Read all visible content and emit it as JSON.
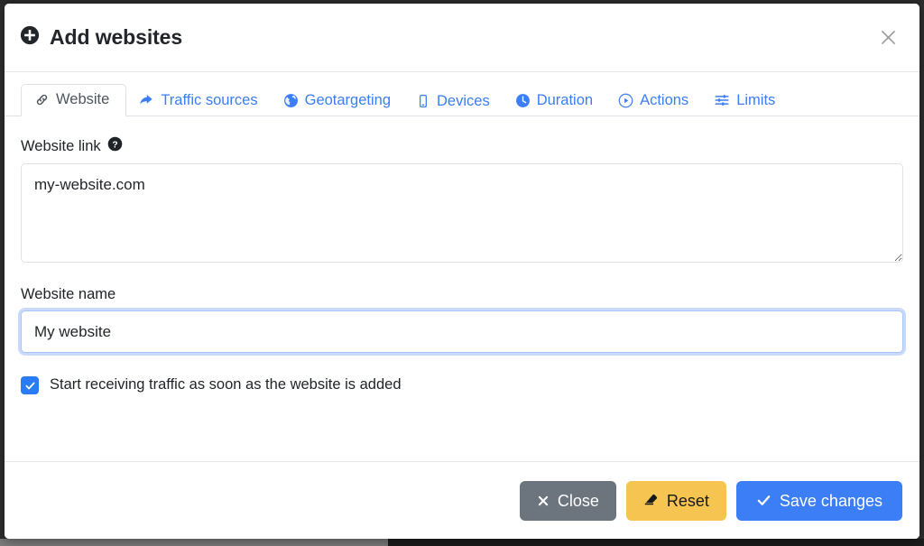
{
  "modal": {
    "title": "Add websites",
    "title_icon": "plus-circle-icon",
    "close_icon": "close-icon"
  },
  "tabs": [
    {
      "label": "Website",
      "icon": "link-icon",
      "active": true
    },
    {
      "label": "Traffic sources",
      "icon": "share-icon",
      "active": false
    },
    {
      "label": "Geotargeting",
      "icon": "globe-icon",
      "active": false
    },
    {
      "label": "Devices",
      "icon": "mobile-icon",
      "active": false
    },
    {
      "label": "Duration",
      "icon": "clock-icon",
      "active": false
    },
    {
      "label": "Actions",
      "icon": "play-icon",
      "active": false
    },
    {
      "label": "Limits",
      "icon": "sliders-icon",
      "active": false
    }
  ],
  "form": {
    "website_link": {
      "label": "Website link",
      "help_icon": "help-circle-icon",
      "value": "my-website.com",
      "placeholder": ""
    },
    "website_name": {
      "label": "Website name",
      "value": "My website",
      "placeholder": ""
    },
    "start_traffic": {
      "label": "Start receiving traffic as soon as the website is added",
      "checked": true
    }
  },
  "footer": {
    "close_label": "Close",
    "close_icon": "x-icon",
    "reset_label": "Reset",
    "reset_icon": "eraser-icon",
    "save_label": "Save changes",
    "save_icon": "check-icon"
  },
  "colors": {
    "accent_blue": "#3b7ef5",
    "reset_yellow": "#f5c451",
    "close_gray": "#6c757d",
    "checkbox_blue": "#2a7bf6",
    "tab_inactive_text": "#3b7ef5",
    "tab_active_text": "#4f555c"
  }
}
